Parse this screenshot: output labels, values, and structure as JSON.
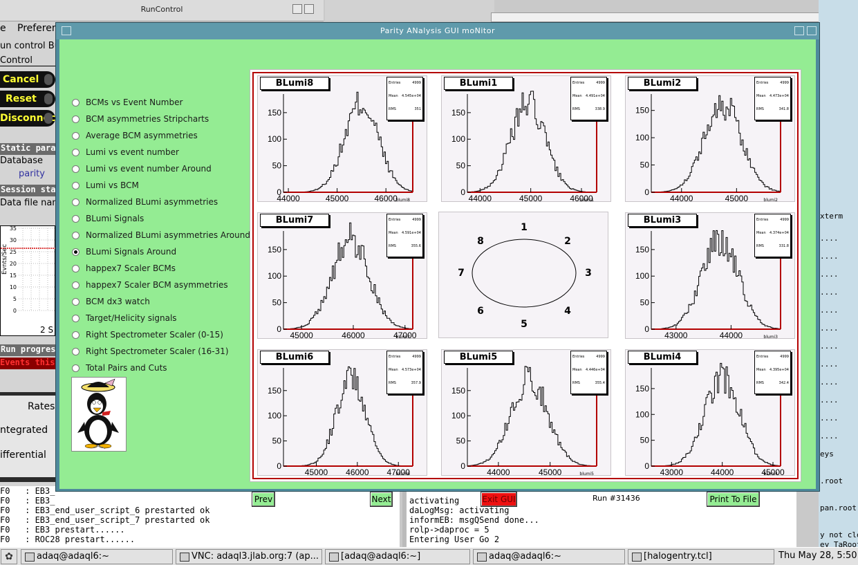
{
  "runcontrol": {
    "title": "RunControl",
    "menu": [
      "e",
      "Preferen"
    ],
    "lines": [
      "un control Bu",
      "Control"
    ],
    "buttons": [
      "Cancel",
      "Reset",
      "Disconnect"
    ],
    "sections": [
      "Static param",
      "Session stat",
      "Run progress"
    ],
    "labels": {
      "database": "Database",
      "parity": "parity",
      "datafile": "Data file nam",
      "events": "Events this",
      "two_s": "2 S",
      "axis": "Evnts/Sec"
    },
    "yticks": [
      "35",
      "30",
      "25",
      "20",
      "15",
      "10",
      "5",
      "0"
    ],
    "rates": [
      "Rates",
      "ntegrated",
      "ifferential"
    ]
  },
  "terminal_left": [
    "F0   : EB3_",
    "F0   : EB3_",
    "F0   : EB3_end_user_script_6 prestarted ok",
    "F0   : EB3_end_user_script_7 prestarted ok",
    "F0   : EB3 prestart......",
    "F0   : ROC28 prestart......"
  ],
  "terminal_right": [
    "activating",
    "daLogMsg: activating",
    "informEB: msgQSend done...",
    "rolp->daproc = 5",
    "Entering User Go 2"
  ],
  "right_bg": {
    "xterm": "xterm",
    "dots": "....",
    "tail": [
      "eys",
      ".root",
      "pan.root",
      "y not closed",
      "ey TaRootRep"
    ]
  },
  "panam": {
    "title": "Parity ANalysis GUI moNitor",
    "options": [
      {
        "label": "BCMs vs Event Number",
        "selected": false
      },
      {
        "label": "BCM asymmetries Stripcharts",
        "selected": false
      },
      {
        "label": "Average BCM asymmetries",
        "selected": false
      },
      {
        "label": "Lumi vs event number",
        "selected": false
      },
      {
        "label": "Lumi vs event number Around",
        "selected": false
      },
      {
        "label": "Lumi vs BCM",
        "selected": false
      },
      {
        "label": "Normalized BLumi asymmetries",
        "selected": false
      },
      {
        "label": "BLumi Signals",
        "selected": false
      },
      {
        "label": "Normalized BLumi asymmetries Around",
        "selected": false
      },
      {
        "label": "BLumi Signals Around",
        "selected": true
      },
      {
        "label": "happex7 Scaler BCMs",
        "selected": false
      },
      {
        "label": "happex7 Scaler BCM asymmetries",
        "selected": false
      },
      {
        "label": "BCM dx3 watch",
        "selected": false
      },
      {
        "label": "Target/Helicity signals",
        "selected": false
      },
      {
        "label": "Right Spectrometer Scaler (0-15)",
        "selected": false
      },
      {
        "label": "Right Spectrometer Scaler (16-31)",
        "selected": false
      },
      {
        "label": "Total Pairs and Cuts",
        "selected": false
      }
    ],
    "buttons": {
      "prev": "Prev",
      "next": "Next",
      "exit": "Exit GUI",
      "print": "Print To File"
    },
    "run": "Run #31436",
    "diagram_labels": [
      "1",
      "2",
      "3",
      "4",
      "5",
      "6",
      "7",
      "8"
    ]
  },
  "chart_data": [
    {
      "type": "histogram",
      "title": "BLumi8",
      "xlabel": "blumi8",
      "xticks": [
        "44000",
        "45000",
        "46000"
      ],
      "yticks": [
        "0",
        "50",
        "100",
        "150"
      ],
      "xlim": [
        43900,
        46550
      ],
      "ylim": [
        0,
        185
      ],
      "mean": 45500,
      "rms": 350,
      "peak": 168,
      "stats": {
        "entries": "4999",
        "mean": "4.545e+04",
        "rms": "351"
      }
    },
    {
      "type": "histogram",
      "title": "BLumi1",
      "xlabel": "blumi1",
      "xticks": [
        "44000",
        "45000",
        "46000"
      ],
      "yticks": [
        "0",
        "50",
        "100",
        "150"
      ],
      "xlim": [
        43750,
        46300
      ],
      "ylim": [
        0,
        185
      ],
      "mean": 44950,
      "rms": 340,
      "peak": 168,
      "stats": {
        "entries": "4999",
        "mean": "4.491e+04",
        "rms": "338.9"
      }
    },
    {
      "type": "histogram",
      "title": "BLumi2",
      "xlabel": "blumi2",
      "xticks": [
        "44000",
        "45000"
      ],
      "yticks": [
        "0",
        "50",
        "100",
        "150"
      ],
      "xlim": [
        43450,
        45800
      ],
      "ylim": [
        0,
        180
      ],
      "mean": 44750,
      "rms": 340,
      "peak": 162,
      "stats": {
        "entries": "4999",
        "mean": "4.473e+04",
        "rms": "341.8"
      }
    },
    {
      "type": "histogram",
      "title": "BLumi7",
      "xlabel": "blumi7",
      "xticks": [
        "45000",
        "46000",
        "47000"
      ],
      "yticks": [
        "0",
        "50",
        "100",
        "150"
      ],
      "xlim": [
        44650,
        47150
      ],
      "ylim": [
        0,
        185
      ],
      "mean": 45950,
      "rms": 355,
      "peak": 170,
      "stats": {
        "entries": "4999",
        "mean": "4.591e+04",
        "rms": "355.6"
      }
    },
    {
      "type": "histogram",
      "title": "BLumi3",
      "xlabel": "blumi3",
      "xticks": [
        "43000",
        "44000"
      ],
      "yticks": [
        "0",
        "50",
        "100",
        "150"
      ],
      "xlim": [
        42550,
        44900
      ],
      "ylim": [
        0,
        185
      ],
      "mean": 43800,
      "rms": 330,
      "peak": 168,
      "stats": {
        "entries": "4999",
        "mean": "4.374e+04",
        "rms": "331.8"
      }
    },
    {
      "type": "histogram",
      "title": "BLumi6",
      "xlabel": "blumi6",
      "xticks": [
        "45000",
        "46000",
        "47000"
      ],
      "yticks": [
        "0",
        "50",
        "100",
        "150"
      ],
      "xlim": [
        44200,
        47350
      ],
      "ylim": [
        0,
        195
      ],
      "mean": 45850,
      "rms": 358,
      "peak": 175,
      "stats": {
        "entries": "4999",
        "mean": "4.573e+04",
        "rms": "357.9"
      }
    },
    {
      "type": "histogram",
      "title": "BLumi5",
      "xlabel": "blumi5",
      "xticks": [
        "44000",
        "45000"
      ],
      "yticks": [
        "0",
        "50",
        "100",
        "150"
      ],
      "xlim": [
        43400,
        45900
      ],
      "ylim": [
        0,
        195
      ],
      "mean": 44600,
      "rms": 355,
      "peak": 175,
      "stats": {
        "entries": "4999",
        "mean": "4.446e+04",
        "rms": "355.4"
      }
    },
    {
      "type": "histogram",
      "title": "BLumi4",
      "xlabel": "blumi4",
      "xticks": [
        "43000",
        "44000",
        "45000"
      ],
      "yticks": [
        "0",
        "50",
        "100",
        "150"
      ],
      "xlim": [
        42600,
        45150
      ],
      "ylim": [
        0,
        190
      ],
      "mean": 44000,
      "rms": 342,
      "peak": 172,
      "stats": {
        "entries": "4999",
        "mean": "4.395e+04",
        "rms": "342.4"
      }
    }
  ],
  "taskbar": {
    "items": [
      "adaq@adaql6:~",
      "VNC: adaql3.jlab.org:7 (ap...",
      "[adaq@adaql6:~]",
      "adaq@adaql6:~",
      "[halogentry.tcl]"
    ],
    "clock": "Thu May 28,  5:50"
  }
}
